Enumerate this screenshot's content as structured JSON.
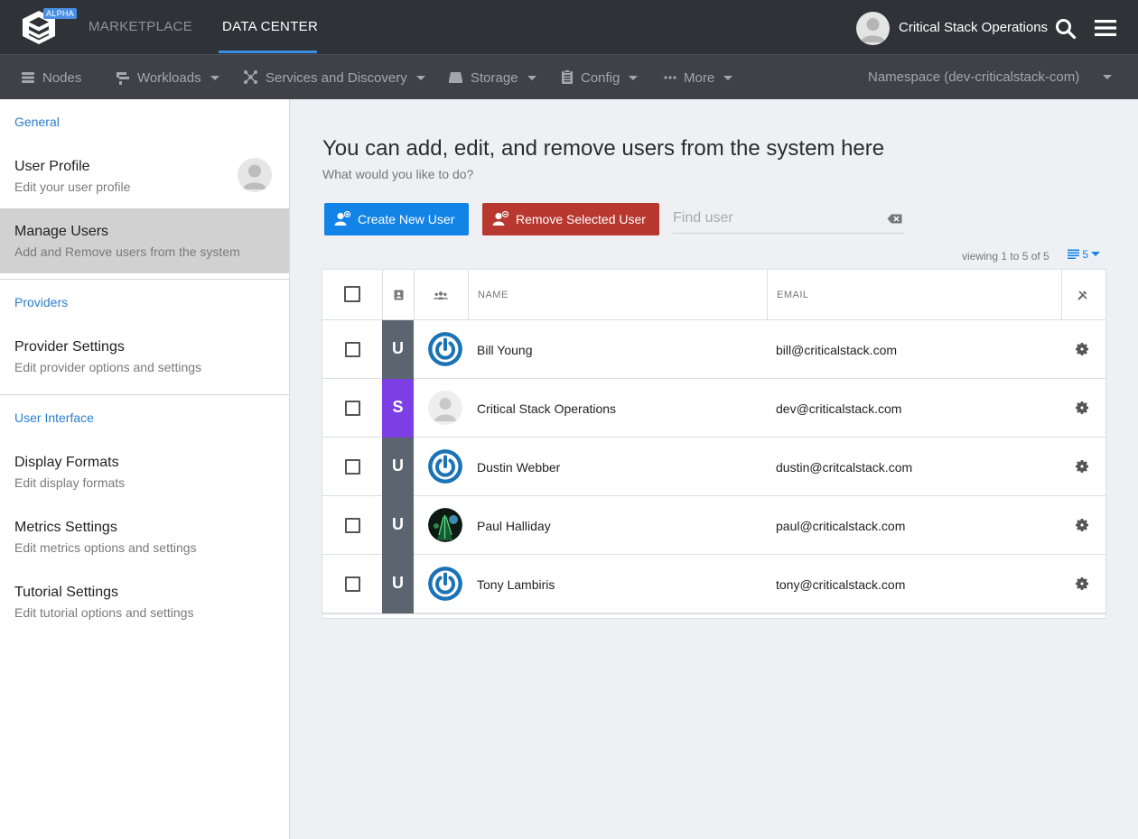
{
  "app": {
    "alpha_badge": "ALPHA",
    "nav": {
      "marketplace": "MARKETPLACE",
      "data_center": "DATA CENTER"
    },
    "user_name": "Critical Stack Operations",
    "accent": "#1283e7"
  },
  "subnav": {
    "items": [
      {
        "label": "Nodes",
        "icon": "nodes-icon",
        "has_caret": false
      },
      {
        "label": "Workloads",
        "icon": "workloads-icon",
        "has_caret": true
      },
      {
        "label": "Services and Discovery",
        "icon": "services-icon",
        "has_caret": true
      },
      {
        "label": "Storage",
        "icon": "storage-icon",
        "has_caret": true
      },
      {
        "label": "Config",
        "icon": "config-icon",
        "has_caret": true
      },
      {
        "label": "More",
        "icon": "more-icon",
        "has_caret": true
      }
    ],
    "namespace": "Namespace (dev-criticalstack-com)"
  },
  "sidebar": {
    "sections": {
      "general": "General",
      "providers": "Providers",
      "user_interface": "User Interface"
    },
    "items": [
      {
        "title": "User Profile",
        "desc": "Edit your user profile"
      },
      {
        "title": "Manage Users",
        "desc": "Add and Remove users from the system"
      },
      {
        "title": "Provider Settings",
        "desc": "Edit provider options and settings"
      },
      {
        "title": "Display Formats",
        "desc": "Edit display formats"
      },
      {
        "title": "Metrics Settings",
        "desc": "Edit metrics options and settings"
      },
      {
        "title": "Tutorial Settings",
        "desc": "Edit tutorial options and settings"
      }
    ]
  },
  "main": {
    "title": "You can add, edit, and remove users from the system here",
    "subtitle": "What would you like to do?",
    "create_label": "Create New User",
    "remove_label": "Remove Selected User",
    "find_placeholder": "Find user",
    "viewing": "viewing 1 to 5 of 5",
    "per_page": "5",
    "columns": {
      "name": "NAME",
      "email": "EMAIL"
    },
    "rows": [
      {
        "role": "U",
        "name": "Bill Young",
        "email": "bill@criticalstack.com",
        "avatar": "power",
        "role_color": "#5a6570"
      },
      {
        "role": "S",
        "name": "Critical Stack Operations",
        "email": "dev@criticalstack.com",
        "avatar": "default",
        "role_color": "#7b3fe4"
      },
      {
        "role": "U",
        "name": "Dustin Webber",
        "email": "dustin@critcalstack.com",
        "avatar": "power",
        "role_color": "#5a6570"
      },
      {
        "role": "U",
        "name": "Paul Halliday",
        "email": "paul@criticalstack.com",
        "avatar": "photo",
        "role_color": "#5a6570"
      },
      {
        "role": "U",
        "name": "Tony Lambiris",
        "email": "tony@criticalstack.com",
        "avatar": "power",
        "role_color": "#5a6570"
      }
    ]
  }
}
